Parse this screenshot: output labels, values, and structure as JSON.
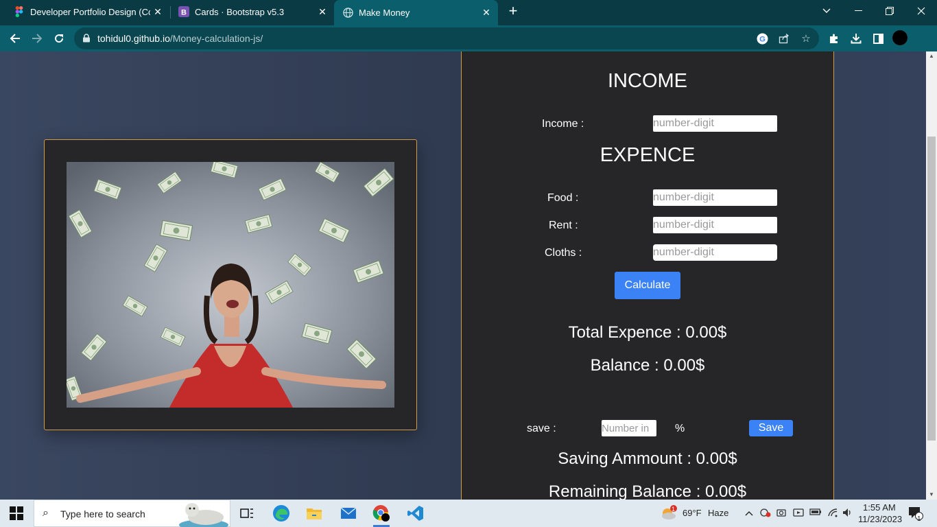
{
  "browser": {
    "tabs": [
      {
        "title": "Developer Portfolio Design (Con",
        "favicon": "figma-icon"
      },
      {
        "title": "Cards · Bootstrap v5.3",
        "favicon": "bootstrap-icon"
      },
      {
        "title": "Make Money",
        "favicon": "globe-icon",
        "active": true
      }
    ],
    "new_tab": "+",
    "url_host": "tohidul0.github.io",
    "url_path": "/Money-calculation-js/"
  },
  "income_section": {
    "heading": "INCOME",
    "income_label": "Income :",
    "income_placeholder": "number-digit"
  },
  "expense_section": {
    "heading": "EXPENCE",
    "food_label": "Food :",
    "rent_label": "Rent :",
    "cloths_label": "Cloths :",
    "placeholder": "number-digit",
    "calculate_label": "Calculate"
  },
  "results": {
    "total_expense": "Total Expence : 0.00$",
    "balance": "Balance : 0.00$"
  },
  "saving_section": {
    "save_label": "save :",
    "save_placeholder": "Number in",
    "percent_sign": "%",
    "save_button": "Save",
    "saving_amount": "Saving Ammount : 0.00$",
    "remaining_balance": "Remaining Balance : 0.00$"
  },
  "taskbar": {
    "search_placeholder": "Type here to search",
    "weather_temp": "69°F",
    "weather_text": "Haze",
    "weather_badge": "1",
    "time": "1:55 AM",
    "date": "11/23/2023",
    "notification_count": "1"
  },
  "colors": {
    "accent_border": "#d49a45",
    "button_blue": "#3b82f6",
    "panel_bg": "#262628",
    "page_bg": "#333d52"
  }
}
